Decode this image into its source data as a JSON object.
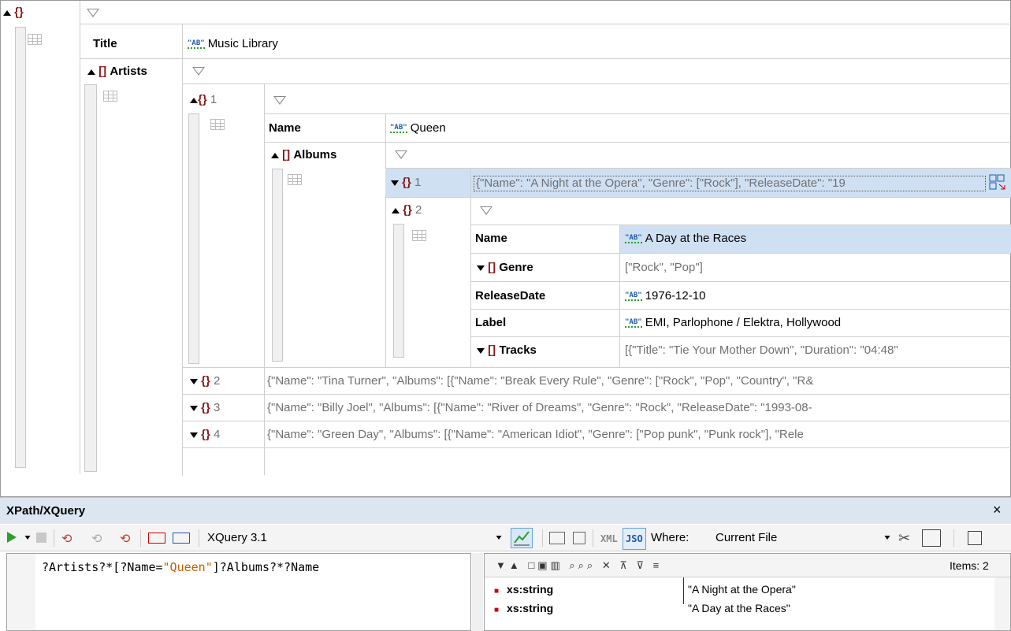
{
  "root": {
    "title_key": "Title",
    "title_value": "Music Library",
    "artists_key": "Artists"
  },
  "artist1": {
    "index": "1",
    "name_key": "Name",
    "name_value": "Queen",
    "albums_key": "Albums"
  },
  "album1": {
    "index": "1",
    "preview": "{\"Name\": \"A Night at the Opera\", \"Genre\": [\"Rock\"], \"ReleaseDate\": \"19"
  },
  "album2": {
    "index": "2",
    "name_key": "Name",
    "name_value": "A Day at the Races",
    "genre_key": "Genre",
    "genre_value": "[\"Rock\", \"Pop\"]",
    "release_key": "ReleaseDate",
    "release_value": "1976-12-10",
    "label_key": "Label",
    "label_value": "EMI, Parlophone / Elektra, Hollywood",
    "tracks_key": "Tracks",
    "tracks_value": "[{\"Title\": \"Tie Your Mother Down\", \"Duration\": \"04:48\""
  },
  "artists_collapsed": [
    {
      "index": "2",
      "preview": "{\"Name\": \"Tina Turner\", \"Albums\": [{\"Name\": \"Break Every Rule\", \"Genre\": [\"Rock\", \"Pop\", \"Country\", \"R&"
    },
    {
      "index": "3",
      "preview": "{\"Name\": \"Billy Joel\", \"Albums\": [{\"Name\": \"River of Dreams\", \"Genre\": \"Rock\", \"ReleaseDate\": \"1993-08-"
    },
    {
      "index": "4",
      "preview": "{\"Name\": \"Green Day\", \"Albums\": [{\"Name\": \"American Idiot\", \"Genre\": [\"Pop punk\", \"Punk rock\"], \"Rele"
    }
  ],
  "icons": {
    "object": "{}",
    "array": "[]",
    "string_badge": "\"AB\""
  },
  "panel": {
    "title": "XPath/XQuery",
    "close": "×",
    "language": "XQuery 3.1",
    "xml_btn": "XML",
    "json_btn": "JSO",
    "where_label": "Where:",
    "where_value": "Current File",
    "items_label": "Items: 2"
  },
  "query": {
    "expr_prefix": "?Artists?*[?Name=",
    "expr_string": "\"Queen\"",
    "expr_suffix": "]?Albums?*?Name"
  },
  "results": [
    {
      "type": "xs:string",
      "value": "\"A Night at the Opera\""
    },
    {
      "type": "xs:string",
      "value": "\"A Day at the Races\""
    }
  ],
  "colors": {
    "selected_row": "#cfe0f3",
    "panel_header": "#dce6f0",
    "accent_red": "#8b1a1a",
    "string_blue": "#1e5aa8"
  }
}
